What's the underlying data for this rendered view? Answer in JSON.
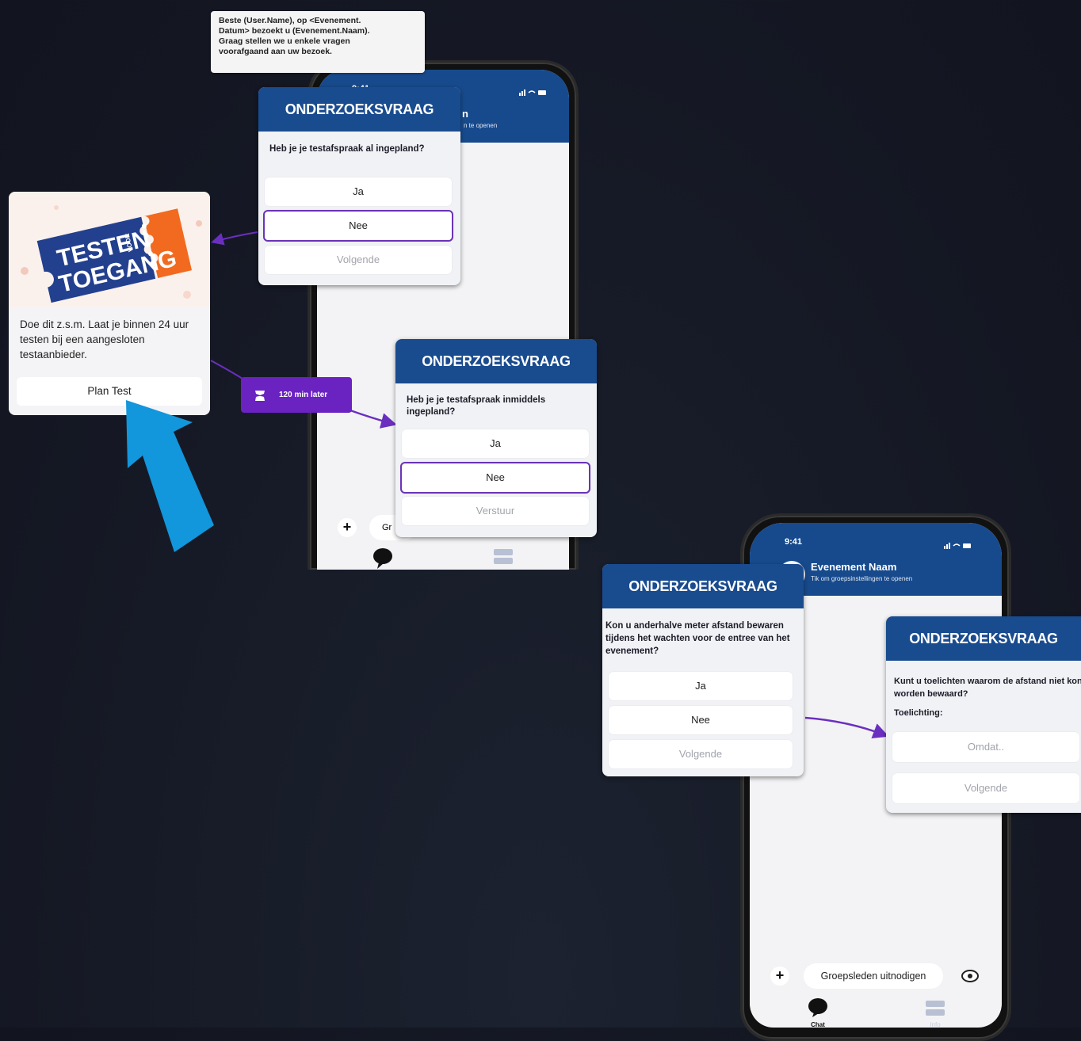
{
  "note": {
    "lines": [
      "Beste (User.Name), op <Evenement.",
      "Datum> bezoekt u (Evenement.Naam).",
      "Graag stellen we u enkele vragen",
      "voorafgaand aan uw bezoek."
    ]
  },
  "phone1": {
    "time": "9:41",
    "header_title_fragment": "n",
    "header_subtitle_fragment": "n te openen",
    "input_fragment": "Gr",
    "plus": "+"
  },
  "q1": {
    "title": "ONDERZOEKSVRAAG",
    "question": "Heb je je testafspraak al ingepland?",
    "options": [
      "Ja",
      "Nee"
    ],
    "next": "Volgende"
  },
  "ticket": {
    "logo_top": "TESTEN",
    "logo_voor": "VOOR",
    "logo_bottom": "TOEGANG",
    "text": "Doe dit z.s.m. Laat je binnen 24 uur testen bij een aangesloten testaanbieder.",
    "button": "Plan Test"
  },
  "delay": {
    "label": "120 min later"
  },
  "q2": {
    "title": "ONDERZOEKSVRAAG",
    "question": "Heb je je testafspraak inmiddels ingepland?",
    "options": [
      "Ja",
      "Nee"
    ],
    "send": "Verstuur"
  },
  "phone2": {
    "time": "9:41",
    "header_title": "Evenement Naam",
    "header_subtitle": "Tik om groepsinstellingen te openen",
    "invite": "Groepsleden uitnodigen",
    "plus": "+",
    "tab_chat": "Chat",
    "tab_info": "Info"
  },
  "q3": {
    "title": "ONDERZOEKSVRAAG",
    "question": "Kon u anderhalve meter afstand bewaren tijdens het wachten voor de entree van het evenement?",
    "options": [
      "Ja",
      "Nee"
    ],
    "next": "Volgende"
  },
  "q4": {
    "title": "ONDERZOEKSVRAAG",
    "question": "Kunt u toelichten waarom de afstand niet kon worden bewaard?",
    "field_label": "Toelichting:",
    "placeholder": "Omdat..",
    "next": "Volgende"
  },
  "colors": {
    "header_blue": "#194b8f",
    "selection_purple": "#6b33b8",
    "arrow_blue": "#1296dc",
    "ticket_blue": "#23408f",
    "ticket_orange": "#f26a1f"
  }
}
